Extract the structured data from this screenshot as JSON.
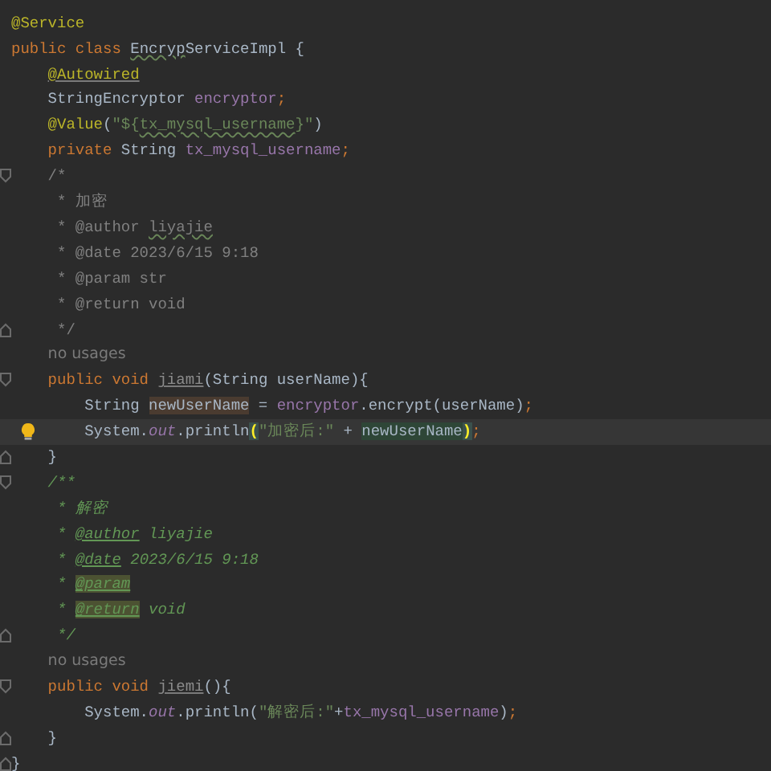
{
  "editor": {
    "lines": [
      {
        "kind": "code",
        "tokens": [
          {
            "text": "@Service",
            "kind": "annotation"
          }
        ]
      },
      {
        "kind": "code",
        "tokens": [
          {
            "text": "public class ",
            "kind": "keyword"
          },
          {
            "text": "Encryp",
            "kind": "plain",
            "typo": true
          },
          {
            "text": "ServiceImpl {",
            "kind": "plain"
          }
        ],
        "children": [
          {
            "kind": "code",
            "tokens": [
              {
                "text": "@Autowired",
                "kind": "annotation",
                "underline": true
              }
            ]
          },
          {
            "kind": "code",
            "tokens": [
              {
                "text": "StringEncryptor ",
                "kind": "plain"
              },
              {
                "text": "encryptor",
                "kind": "field"
              },
              {
                "text": ";",
                "kind": "punct"
              }
            ]
          },
          {
            "kind": "code",
            "tokens": [
              {
                "text": "@Value",
                "kind": "annotation"
              },
              {
                "text": "(",
                "kind": "plain"
              },
              {
                "text": "\"${",
                "kind": "string"
              },
              {
                "text": "tx_mysql_username",
                "kind": "string",
                "typo": true
              },
              {
                "text": "}\"",
                "kind": "string"
              },
              {
                "text": ")",
                "kind": "plain"
              }
            ]
          },
          {
            "kind": "code",
            "tokens": [
              {
                "text": "private ",
                "kind": "keyword"
              },
              {
                "text": "String ",
                "kind": "plain"
              },
              {
                "text": "tx_mysql_username",
                "kind": "field"
              },
              {
                "text": ";",
                "kind": "punct"
              }
            ]
          },
          {
            "kind": "code",
            "gutter": {
              "kind": "fold_start"
            },
            "tokens": [
              {
                "text": "/*",
                "kind": "comment"
              }
            ]
          },
          {
            "kind": "code",
            "tokens": [
              {
                "text": " * 加密",
                "kind": "comment"
              }
            ]
          },
          {
            "kind": "code",
            "tokens": [
              {
                "text": " * @author ",
                "kind": "comment"
              },
              {
                "text": "liyajie",
                "kind": "comment",
                "typo": true
              }
            ]
          },
          {
            "kind": "code",
            "tokens": [
              {
                "text": " * @date 2023/6/15 9:18",
                "kind": "comment"
              }
            ]
          },
          {
            "kind": "code",
            "tokens": [
              {
                "text": " * @param str",
                "kind": "comment"
              }
            ]
          },
          {
            "kind": "code",
            "tokens": [
              {
                "text": " * @return void",
                "kind": "comment"
              }
            ]
          },
          {
            "kind": "code",
            "gutter": {
              "kind": "fold_end"
            },
            "tokens": [
              {
                "text": " */",
                "kind": "comment"
              }
            ]
          },
          {
            "kind": "hint",
            "text": "no usages"
          },
          {
            "kind": "code",
            "gutter": {
              "kind": "fold_start"
            },
            "tokens": [
              {
                "text": "public void ",
                "kind": "keyword"
              },
              {
                "text": "jiami",
                "kind": "method",
                "underline": true
              },
              {
                "text": "(String userName){",
                "kind": "plain"
              }
            ],
            "children": [
              {
                "kind": "code",
                "tokens": [
                  {
                    "text": "String ",
                    "kind": "plain"
                  },
                  {
                    "text": "newUserName",
                    "kind": "plain",
                    "highlight": {
                      "kind": "write"
                    }
                  },
                  {
                    "text": " = ",
                    "kind": "plain"
                  },
                  {
                    "text": "encryptor",
                    "kind": "field"
                  },
                  {
                    "text": ".encrypt(userName)",
                    "kind": "plain"
                  },
                  {
                    "text": ";",
                    "kind": "punct"
                  }
                ]
              },
              {
                "kind": "code",
                "current": true,
                "gutter": {
                  "kind": "bulb"
                },
                "tokens": [
                  {
                    "text": "System.",
                    "kind": "plain"
                  },
                  {
                    "text": "out",
                    "kind": "static"
                  },
                  {
                    "text": ".println",
                    "kind": "plain"
                  },
                  {
                    "text": "(",
                    "kind": "plain",
                    "highlight": {
                      "kind": "brace"
                    }
                  },
                  {
                    "text": "\"加密后:\"",
                    "kind": "string"
                  },
                  {
                    "text": " + ",
                    "kind": "plain"
                  },
                  {
                    "text": "newUserName",
                    "kind": "plain",
                    "highlight": {
                      "kind": "read"
                    }
                  },
                  {
                    "text": ")",
                    "kind": "plain",
                    "highlight": {
                      "kind": "brace"
                    }
                  },
                  {
                    "text": ";",
                    "kind": "punct"
                  }
                ]
              }
            ]
          },
          {
            "kind": "code",
            "gutter": {
              "kind": "fold_end"
            },
            "tokens": [
              {
                "text": "}",
                "kind": "plain"
              }
            ]
          },
          {
            "kind": "code",
            "gutter": {
              "kind": "fold_start"
            },
            "tokens": [
              {
                "text": "/**",
                "kind": "doc"
              }
            ]
          },
          {
            "kind": "code",
            "tokens": [
              {
                "text": " * 解密",
                "kind": "doc"
              }
            ]
          },
          {
            "kind": "code",
            "tokens": [
              {
                "text": " * ",
                "kind": "doc"
              },
              {
                "text": "@author",
                "kind": "doctag"
              },
              {
                "text": " liyajie",
                "kind": "doc"
              }
            ]
          },
          {
            "kind": "code",
            "tokens": [
              {
                "text": " * ",
                "kind": "doc"
              },
              {
                "text": "@date",
                "kind": "doctag"
              },
              {
                "text": " 2023/6/15 9:18",
                "kind": "doc"
              }
            ]
          },
          {
            "kind": "code",
            "tokens": [
              {
                "text": " * ",
                "kind": "doc"
              },
              {
                "text": "@param",
                "kind": "doctag",
                "highlight": {
                  "kind": "tag"
                }
              }
            ]
          },
          {
            "kind": "code",
            "tokens": [
              {
                "text": " * ",
                "kind": "doc"
              },
              {
                "text": "@return",
                "kind": "doctag",
                "highlight": {
                  "kind": "tag"
                }
              },
              {
                "text": " void",
                "kind": "doc"
              }
            ]
          },
          {
            "kind": "code",
            "gutter": {
              "kind": "fold_end"
            },
            "tokens": [
              {
                "text": " */",
                "kind": "doc"
              }
            ]
          },
          {
            "kind": "hint",
            "text": "no usages"
          },
          {
            "kind": "code",
            "gutter": {
              "kind": "fold_start"
            },
            "tokens": [
              {
                "text": "public void ",
                "kind": "keyword"
              },
              {
                "text": "jiemi",
                "kind": "method",
                "underline": true
              },
              {
                "text": "(){",
                "kind": "plain"
              }
            ],
            "children": [
              {
                "kind": "code",
                "tokens": [
                  {
                    "text": "System.",
                    "kind": "plain"
                  },
                  {
                    "text": "out",
                    "kind": "static"
                  },
                  {
                    "text": ".println(",
                    "kind": "plain"
                  },
                  {
                    "text": "\"解密后:\"",
                    "kind": "string"
                  },
                  {
                    "text": "+",
                    "kind": "plain"
                  },
                  {
                    "text": "tx_mysql_username",
                    "kind": "field"
                  },
                  {
                    "text": ")",
                    "kind": "plain"
                  },
                  {
                    "text": ";",
                    "kind": "punct"
                  }
                ]
              }
            ]
          },
          {
            "kind": "code",
            "gutter": {
              "kind": "fold_end"
            },
            "tokens": [
              {
                "text": "}",
                "kind": "plain"
              }
            ]
          }
        ]
      },
      {
        "kind": "code",
        "gutter": {
          "kind": "fold_end"
        },
        "tokens": [
          {
            "text": "}",
            "kind": "plain"
          }
        ]
      }
    ]
  }
}
